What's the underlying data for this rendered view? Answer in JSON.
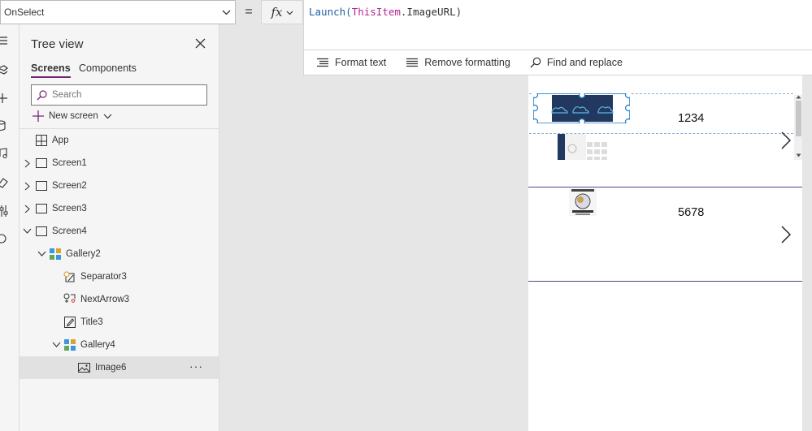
{
  "formula_bar": {
    "property": "OnSelect",
    "equals": "=",
    "fx": "fx",
    "tokens": {
      "fn": "Launch(",
      "kw": "ThisItem",
      "rest": ".ImageURL)"
    }
  },
  "toolbar": {
    "format_text": "Format text",
    "remove_formatting": "Remove formatting",
    "find_replace": "Find and replace"
  },
  "tree_view": {
    "title": "Tree view",
    "tabs": {
      "screens": "Screens",
      "components": "Components"
    },
    "search_placeholder": "Search",
    "new_screen": "New screen",
    "nodes": {
      "app": "App",
      "screen1": "Screen1",
      "screen2": "Screen2",
      "screen3": "Screen3",
      "screen4": "Screen4",
      "gallery2": "Gallery2",
      "separator3": "Separator3",
      "nextarrow3": "NextArrow3",
      "title3": "Title3",
      "gallery4": "Gallery4",
      "image6": "Image6"
    },
    "more_options": "···"
  },
  "canvas": {
    "rows": [
      {
        "title": "1234"
      },
      {
        "title": "5678"
      }
    ]
  },
  "colors": {
    "accent": "#742774",
    "selection": "#1e7fcb",
    "image_dark": "#22385e"
  }
}
